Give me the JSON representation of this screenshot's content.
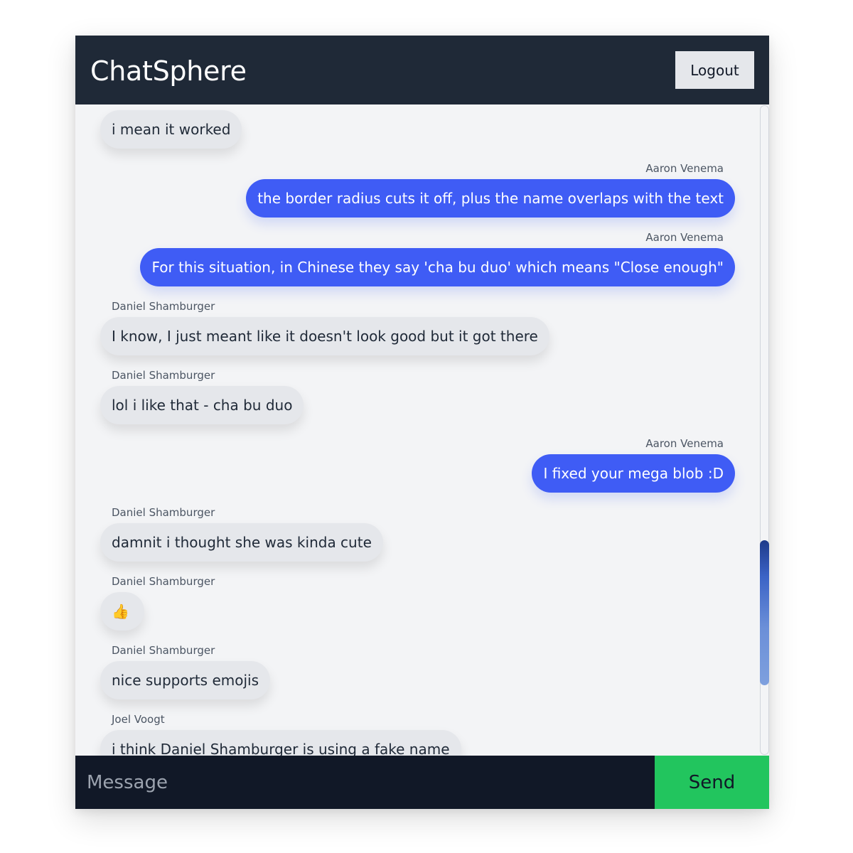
{
  "header": {
    "title": "ChatSphere",
    "logout_label": "Logout"
  },
  "messages": [
    {
      "sender": "",
      "text": "i mean it worked",
      "direction": "incoming"
    },
    {
      "sender": "Aaron Venema",
      "text": "the border radius cuts it off, plus the name overlaps with the text",
      "direction": "outgoing"
    },
    {
      "sender": "Aaron Venema",
      "text": "For this situation, in Chinese they say 'cha bu duo' which means \"Close enough\"",
      "direction": "outgoing"
    },
    {
      "sender": "Daniel Shamburger",
      "text": "I know, I just meant like it doesn't look good but it got there",
      "direction": "incoming"
    },
    {
      "sender": "Daniel Shamburger",
      "text": "lol i like that - cha bu duo",
      "direction": "incoming"
    },
    {
      "sender": "Aaron Venema",
      "text": "I fixed your mega blob :D",
      "direction": "outgoing"
    },
    {
      "sender": "Daniel Shamburger",
      "text": "damnit i thought she was kinda cute",
      "direction": "incoming"
    },
    {
      "sender": "Daniel Shamburger",
      "text": "👍",
      "direction": "incoming"
    },
    {
      "sender": "Daniel Shamburger",
      "text": "nice supports emojis",
      "direction": "incoming"
    },
    {
      "sender": "Joel Voogt",
      "text": "i think Daniel Shamburger is using a fake name",
      "direction": "incoming"
    }
  ],
  "composer": {
    "placeholder": "Message",
    "value": "",
    "send_label": "Send"
  },
  "colors": {
    "header_bg": "#1f2937",
    "outgoing_bubble": "#3f5cf5",
    "incoming_bubble": "#e5e7eb",
    "send_button": "#22c55e",
    "footer_bg": "#111827"
  }
}
